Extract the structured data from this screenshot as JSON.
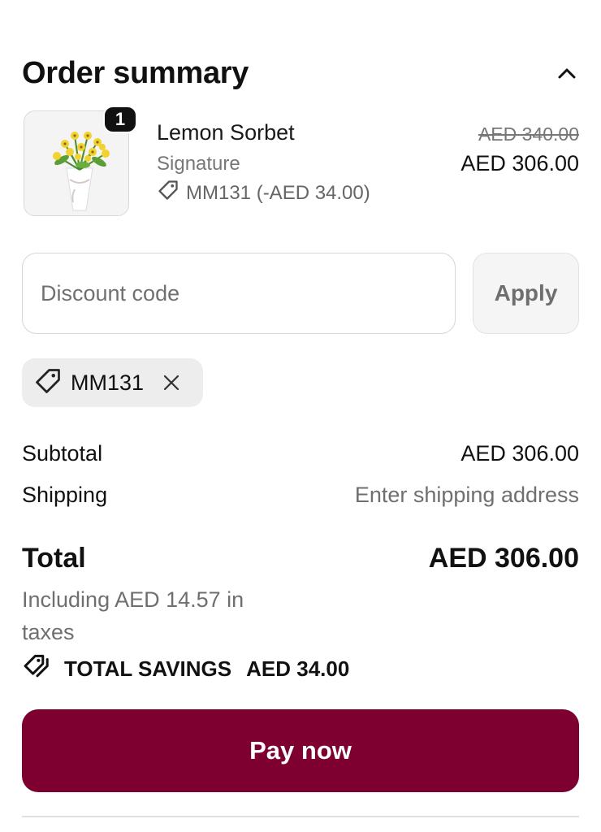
{
  "header": {
    "title": "Order summary"
  },
  "product": {
    "quantity": "1",
    "name": "Lemon Sorbet",
    "variant": "Signature",
    "discount_line": "MM131 (-AED 34.00)",
    "original_price": "AED 340.00",
    "price": "AED 306.00",
    "image": "bouquet-of-yellow-flowers"
  },
  "discount": {
    "placeholder": "Discount code",
    "apply_label": "Apply",
    "applied_code": "MM131"
  },
  "lines": {
    "subtotal_label": "Subtotal",
    "subtotal_value": "AED 306.00",
    "shipping_label": "Shipping",
    "shipping_value": "Enter shipping address"
  },
  "total": {
    "label": "Total",
    "value": "AED 306.00",
    "tax_note": "Including AED 14.57 in taxes"
  },
  "savings": {
    "label": "TOTAL SAVINGS",
    "value": "AED 34.00"
  },
  "pay": {
    "label": "Pay now"
  },
  "colors": {
    "accent": "#7d0030",
    "chip_bg": "#ededed",
    "muted_text": "#6f6f6f"
  },
  "icons": {
    "collapse": "chevron-up-icon",
    "tag": "tag-icon",
    "remove": "close-icon",
    "savings": "tags-icon"
  }
}
